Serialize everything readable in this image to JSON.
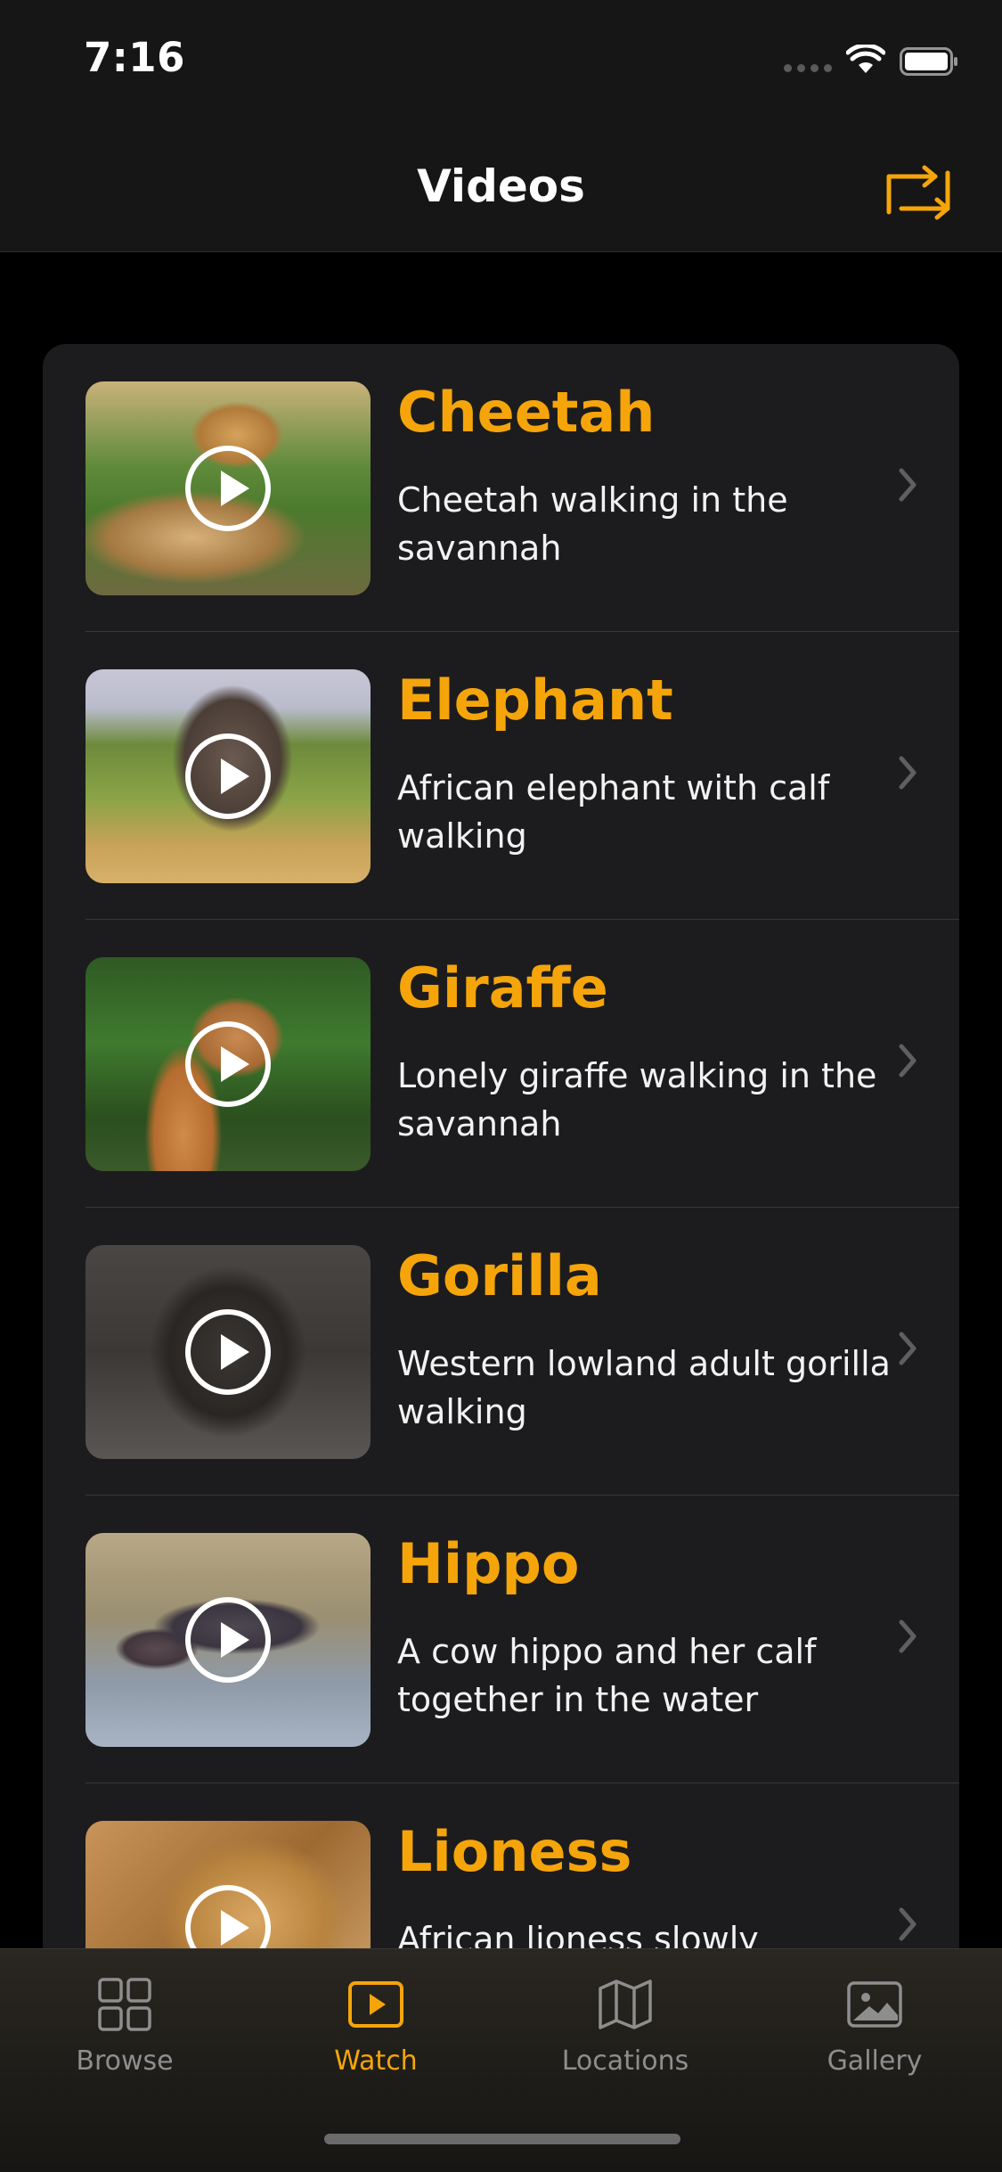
{
  "status_bar": {
    "time": "7:16"
  },
  "nav": {
    "title": "Videos",
    "refresh_icon": "refresh-swap-icon"
  },
  "videos": [
    {
      "title": "Cheetah",
      "description": "Cheetah walking in the savannah"
    },
    {
      "title": "Elephant",
      "description": "African elephant with calf walking"
    },
    {
      "title": "Giraffe",
      "description": "Lonely giraffe walking in the savannah"
    },
    {
      "title": "Gorilla",
      "description": "Western lowland adult gorilla walking"
    },
    {
      "title": "Hippo",
      "description": "A cow hippo and her calf together in the water"
    },
    {
      "title": "Lioness",
      "description": "African lioness slowly walking"
    }
  ],
  "tabs": [
    {
      "label": "Browse",
      "icon": "grid-icon",
      "active": false
    },
    {
      "label": "Watch",
      "icon": "play-rectangle-icon",
      "active": true
    },
    {
      "label": "Locations",
      "icon": "map-icon",
      "active": false
    },
    {
      "label": "Gallery",
      "icon": "photo-icon",
      "active": false
    }
  ],
  "colors": {
    "accent": "#f5a50a",
    "background": "#000000",
    "card": "#1c1c1e",
    "inactive": "#8e8e8e"
  }
}
